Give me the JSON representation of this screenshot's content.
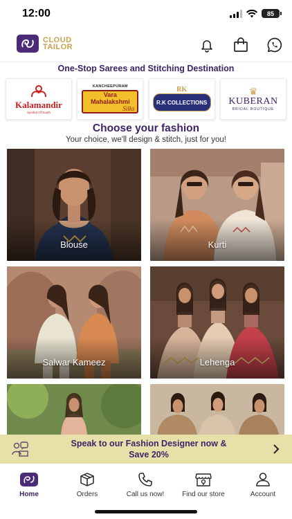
{
  "status_bar": {
    "time": "12:00",
    "battery": "85"
  },
  "header": {
    "brand_line1": "CLOUD",
    "brand_line2": "TAILOR",
    "icons": [
      "bell-icon",
      "shopping-bag-icon",
      "whatsapp-icon"
    ]
  },
  "tagline": "One-Stop Sarees and Stitching Destination",
  "brands": {
    "kalamandir": {
      "name": "Kalamandir",
      "sub": "Symbol Of South"
    },
    "vara": {
      "top": "KANCHEEPURAM",
      "name_line1": "Vara",
      "name_line2": "Mahalakshmi",
      "silks": "Silks"
    },
    "rk": {
      "monogram": "RK",
      "name": "R.K COLLECTIONS"
    },
    "kuberan": {
      "name": "KUBERAN",
      "sub": "BRIDAL BOUTIQUE"
    }
  },
  "section": {
    "title": "Choose your fashion",
    "subtitle": "Your choice, we'll design & stitch, just for you!"
  },
  "categories": [
    {
      "label": "Blouse"
    },
    {
      "label": "Kurti"
    },
    {
      "label": "Salwar Kameez"
    },
    {
      "label": "Lehenga"
    },
    {
      "label": ""
    },
    {
      "label": ""
    }
  ],
  "promo": {
    "line1": "Speak to our Fashion Designer now &",
    "line2": "Save 20%"
  },
  "tabs": [
    {
      "label": "Home",
      "icon": "home-logo-icon",
      "active": true
    },
    {
      "label": "Orders",
      "icon": "box-icon",
      "active": false
    },
    {
      "label": "Call us now!",
      "icon": "phone-icon",
      "active": false
    },
    {
      "label": "Find our store",
      "icon": "store-icon",
      "active": false
    },
    {
      "label": "Account",
      "icon": "user-icon",
      "active": false
    }
  ],
  "colors": {
    "brand_purple": "#3d2466",
    "gold": "#c9a14a",
    "promo_bg": "#e7e0a9"
  }
}
